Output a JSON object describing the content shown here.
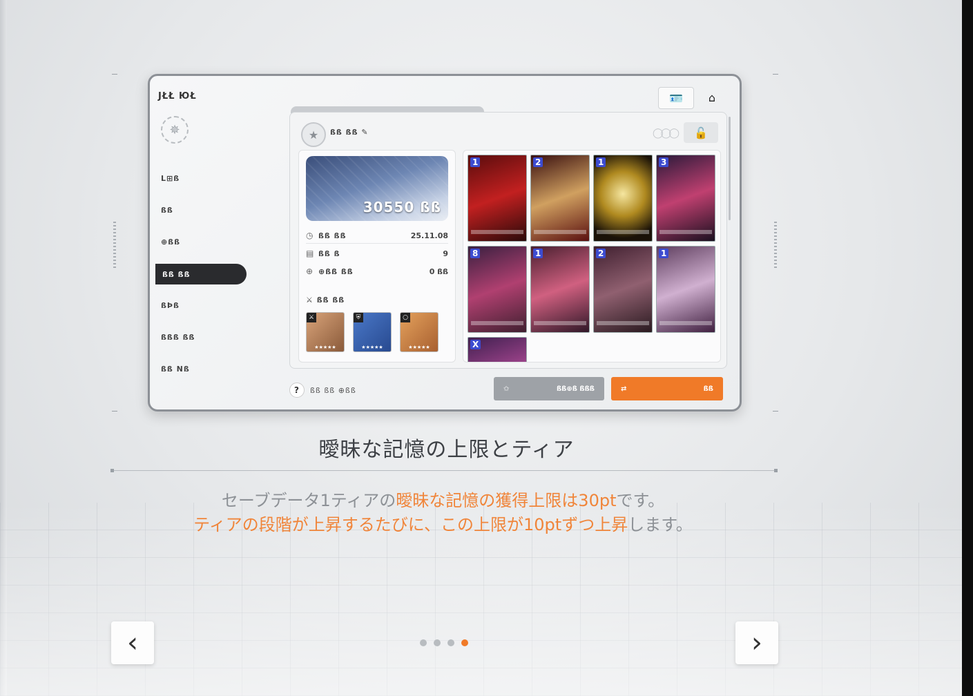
{
  "screenshot": {
    "window_title": "JŁŁ ЮŁ",
    "nav": {
      "items": [
        "L⊞ß",
        "ßß",
        "⊕ßß",
        "ßß ßß",
        "ßÞß",
        "ßßß ßß",
        "ßß Nß"
      ],
      "active_index": 3
    },
    "deck": {
      "name": "ßß ßß",
      "score": "30550 ßß",
      "rows": [
        {
          "icon": "clock-icon",
          "label": "ßß ßß",
          "value": "25.11.08"
        },
        {
          "icon": "card-icon",
          "label": "ßß ß",
          "value": "9"
        },
        {
          "icon": "globe-icon",
          "label": "⊕ßß ßß",
          "value": "0 ßß"
        }
      ],
      "equipment_title": "ßß ßß",
      "card_costs": [
        "1",
        "2",
        "1",
        "3",
        "8",
        "1",
        "2",
        "1",
        "X"
      ]
    },
    "help_text": "ßß ßß ⊕ßß",
    "gray_button_label": "ßß⊕ß ßßß",
    "orange_button_label": "ßß"
  },
  "slide": {
    "title": "曖昧な記憶の上限とティア",
    "line1_prefix": "セーブデータ1ティアの",
    "line1_highlight": "曖昧な記憶の獲得上限は30pt",
    "line1_suffix": "です。",
    "line2_highlight": "ティアの段階が上昇するたびに、この上限が10ptずつ上昇",
    "line2_suffix": "します。"
  },
  "pagination": {
    "total": 4,
    "active_index": 3
  },
  "colors": {
    "accent": "#f07a28",
    "dark": "#2a2b2e"
  }
}
